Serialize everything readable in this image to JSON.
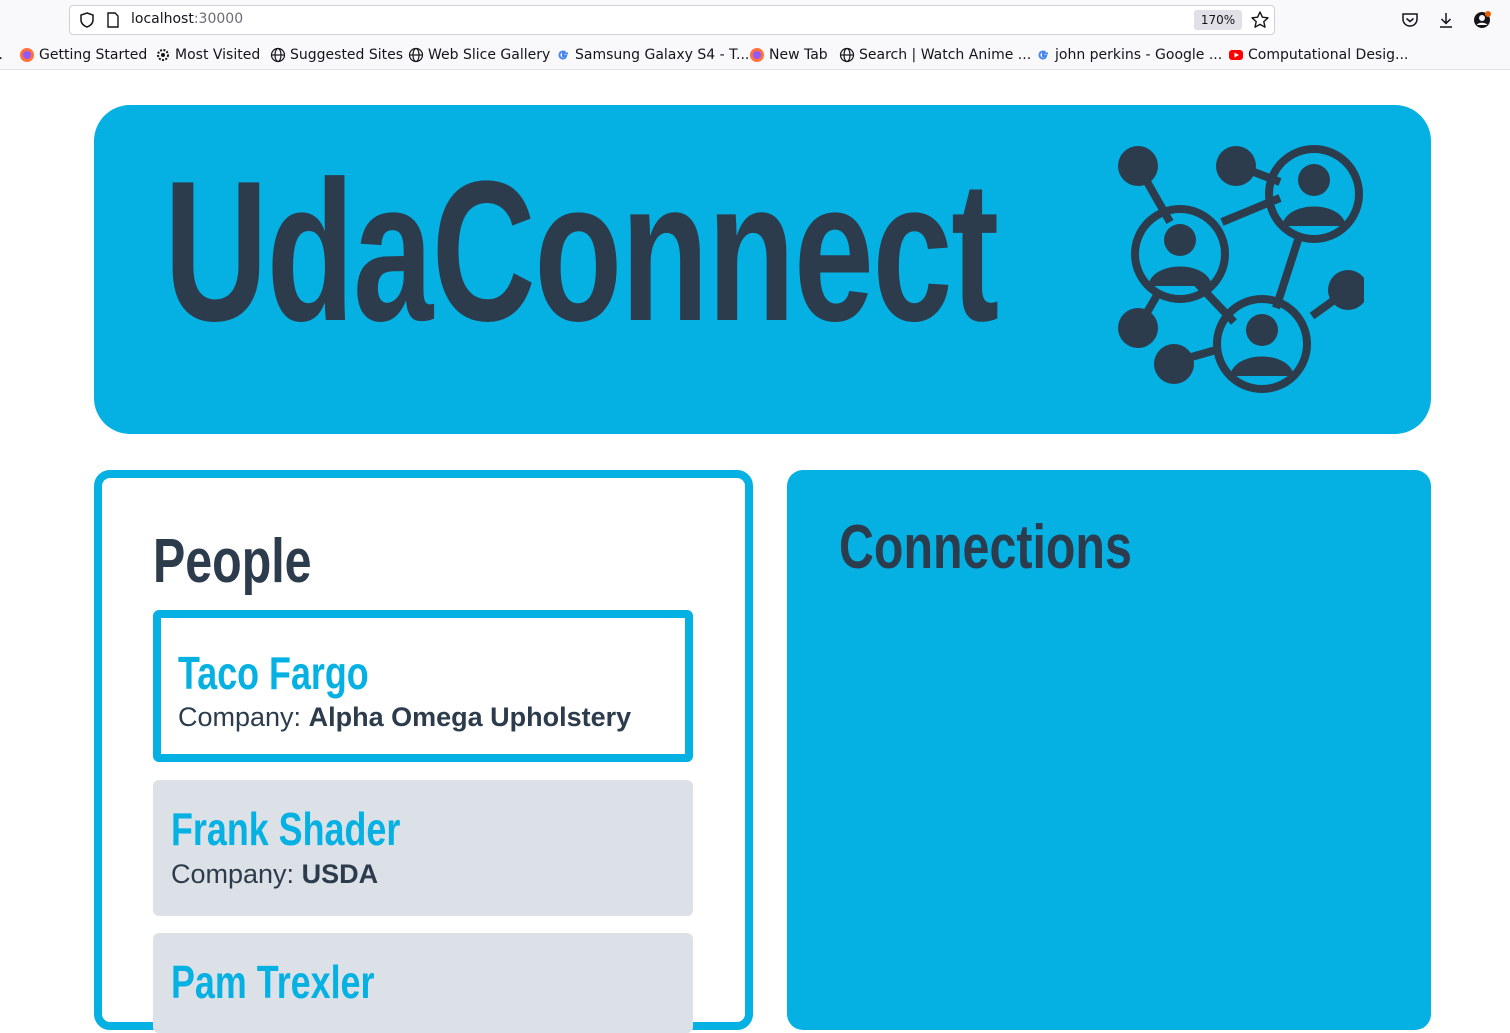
{
  "browser": {
    "url_host": "localhost",
    "url_port": ":30000",
    "zoom": "170%",
    "bookmarks": [
      {
        "label": "Getting Started",
        "icon": "firefox-icon"
      },
      {
        "label": "Most Visited",
        "icon": "gear-icon"
      },
      {
        "label": "Suggested Sites",
        "icon": "globe-icon"
      },
      {
        "label": "Web Slice Gallery",
        "icon": "globe-icon"
      },
      {
        "label": "Samsung Galaxy S4 - T...",
        "icon": "google-icon"
      },
      {
        "label": "New Tab",
        "icon": "firefox-icon"
      },
      {
        "label": "Search | Watch Anime ...",
        "icon": "globe-icon"
      },
      {
        "label": "john perkins - Google ...",
        "icon": "google-icon"
      },
      {
        "label": "Computational Desig...",
        "icon": "youtube-icon"
      }
    ]
  },
  "hero": {
    "title": "UdaConnect",
    "icon": "network-people-icon"
  },
  "people": {
    "heading": "People",
    "company_label": "Company:",
    "items": [
      {
        "name": "Taco Fargo",
        "company": "Alpha Omega Upholstery",
        "selected": true
      },
      {
        "name": "Frank Shader",
        "company": "USDA",
        "selected": false
      },
      {
        "name": "Pam Trexler",
        "company": "",
        "selected": false
      }
    ]
  },
  "connections": {
    "heading": "Connections"
  },
  "colors": {
    "accent": "#04b1e2",
    "dark": "#2d3c4c",
    "card_bg": "#dce1e7"
  }
}
